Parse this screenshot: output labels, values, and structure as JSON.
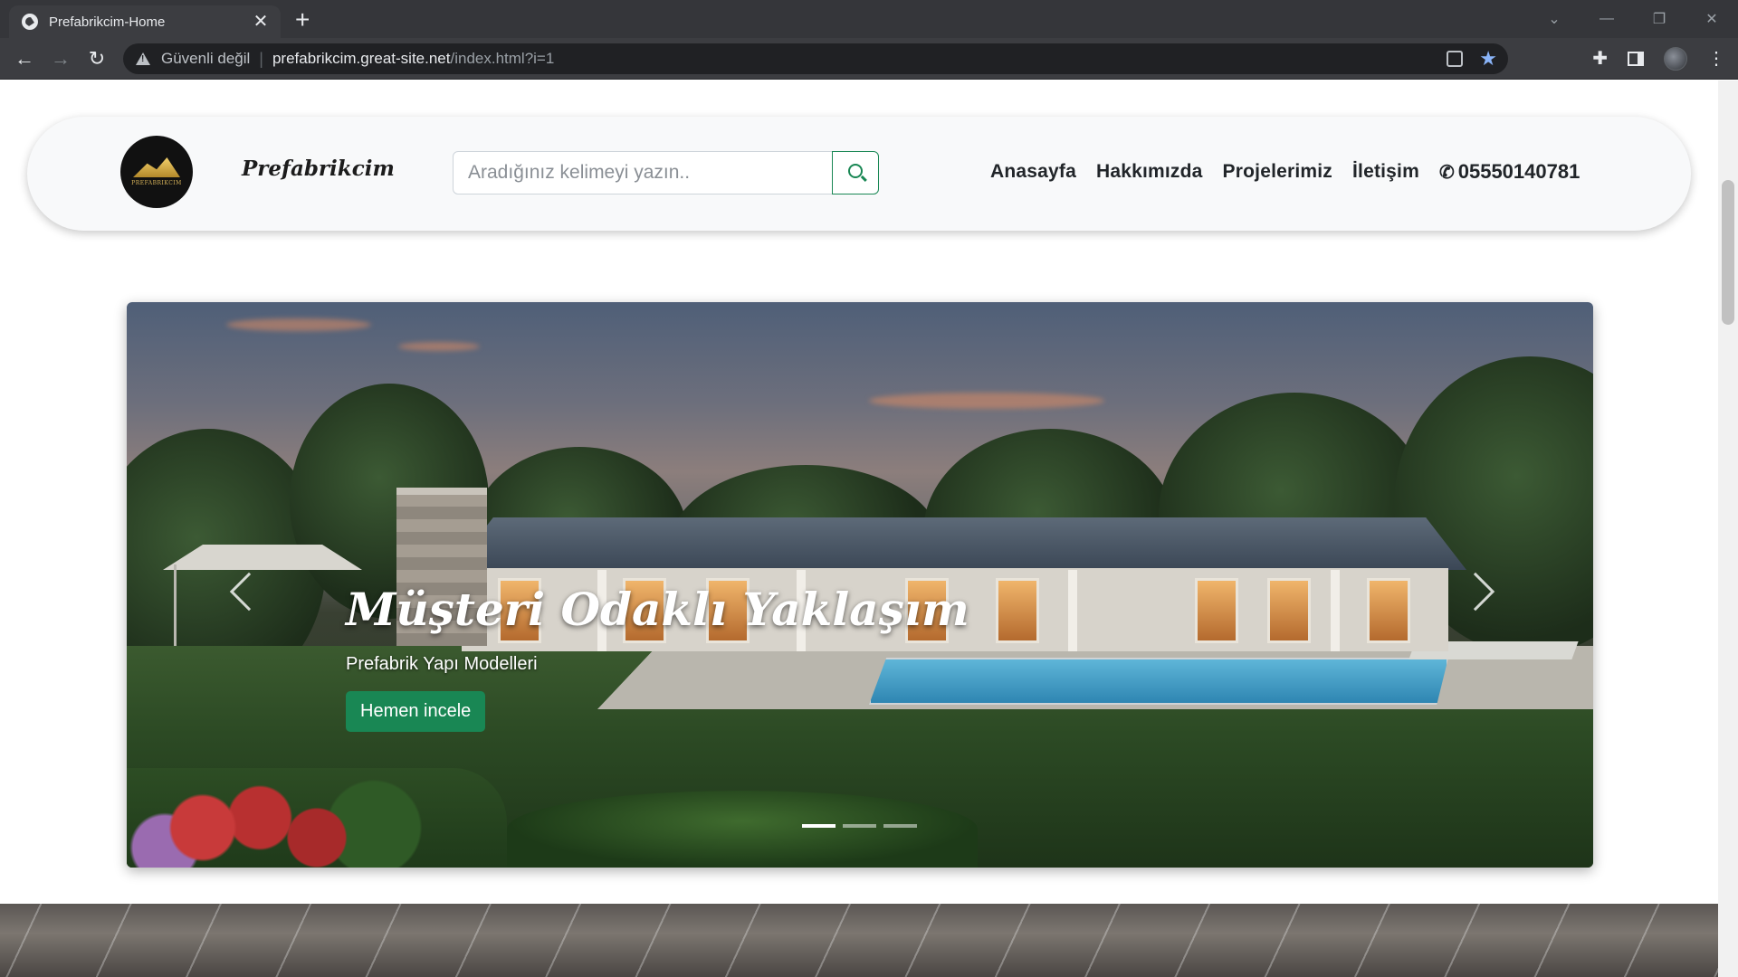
{
  "browser": {
    "tab_title": "Prefabrikcim-Home",
    "tab_close": "✕",
    "new_tab": "+",
    "security_label": "Güvenli değil",
    "url_host": "prefabrikcim.great-site.net",
    "url_path": "/index.html?i=1"
  },
  "site": {
    "brand": "Prefabrikcim",
    "logo_text": "PREFABRIKCIM",
    "search_placeholder": "Aradığınız kelimeyi yazın..",
    "nav": [
      "Anasayfa",
      "Hakkımızda",
      "Projelerimiz",
      "İletişim"
    ],
    "phone": "05550140781",
    "accent_color": "#198754"
  },
  "carousel": {
    "title": "Müşteri Odaklı Yaklaşım",
    "subtitle": "Prefabrik Yapı Modelleri",
    "button_label": "Hemen incele",
    "slide_count": 3,
    "active_slide": 1
  }
}
